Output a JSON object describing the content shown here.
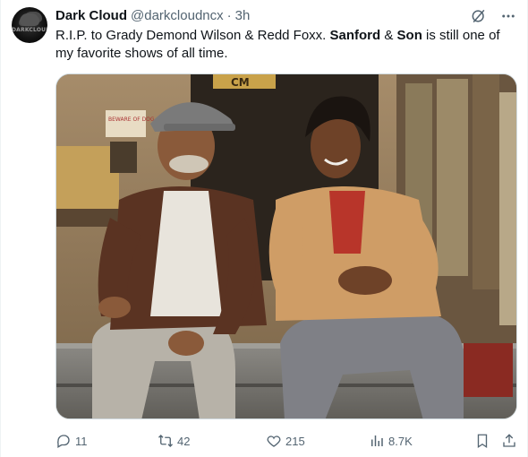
{
  "author": {
    "name": "Dark Cloud",
    "handle": "@darkcloudncx",
    "separator": "·",
    "time": "3h",
    "avatar_text": "DARKCLOUDNC"
  },
  "tweet": {
    "text_part1": "R.I.P. to Grady Demond Wilson & Redd Foxx. ",
    "bold1": "Sanford",
    "text_part2": " & ",
    "bold2": "Son",
    "text_part3": " is still one of my favorite shows of all time."
  },
  "header_icons": [
    "grok-icon",
    "more-icon"
  ],
  "photo": {
    "sign_top": "CM",
    "sign_left": "BEWARE OF DOG"
  },
  "actions": {
    "replies": "11",
    "reposts": "42",
    "likes": "215",
    "views": "8.7K"
  },
  "colors": {
    "text": "#0f1419",
    "secondary": "#536471",
    "border": "#cfd9de"
  }
}
